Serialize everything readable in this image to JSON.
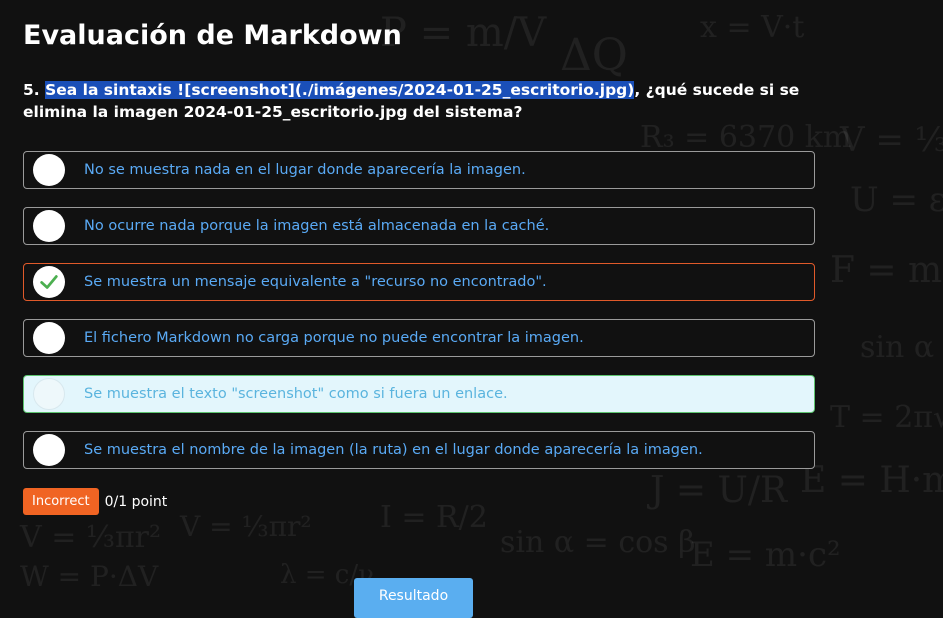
{
  "page": {
    "title": "Evaluación de Markdown"
  },
  "question": {
    "number": "5.",
    "highlighted": "Sea la sintaxis ![screenshot](./imágenes/2024-01-25_escritorio.jpg)",
    "rest": ", ¿qué sucede si se elimina la imagen 2024-01-25_escritorio.jpg del sistema?"
  },
  "options": [
    {
      "label": "No se muestra nada en el lugar donde aparecería la imagen.",
      "state": "unselected"
    },
    {
      "label": "No ocurre nada porque la imagen está almacenada en la caché.",
      "state": "unselected"
    },
    {
      "label": "Se muestra un mensaje equivalente a \"recurso no encontrado\".",
      "state": "selected-wrong"
    },
    {
      "label": "El fichero Markdown no carga porque no puede encontrar la imagen.",
      "state": "unselected"
    },
    {
      "label": "Se muestra el texto \"screenshot\" como si fuera un enlace.",
      "state": "correct"
    },
    {
      "label": "Se muestra el nombre de la imagen (la ruta) en el lugar donde aparecería la imagen.",
      "state": "unselected"
    }
  ],
  "result": {
    "badge": "Incorrect",
    "points": "0/1 point"
  },
  "button": {
    "label": "Resultado"
  },
  "colors": {
    "background": "#111111",
    "option_text": "#5aaaf5",
    "badge": "#f06423",
    "selected_border": "#e05a2a",
    "correct_border": "#5cc46e",
    "correct_bg": "#e3f6fc",
    "check": "#4caf50",
    "highlight": "#1a4fb8"
  }
}
